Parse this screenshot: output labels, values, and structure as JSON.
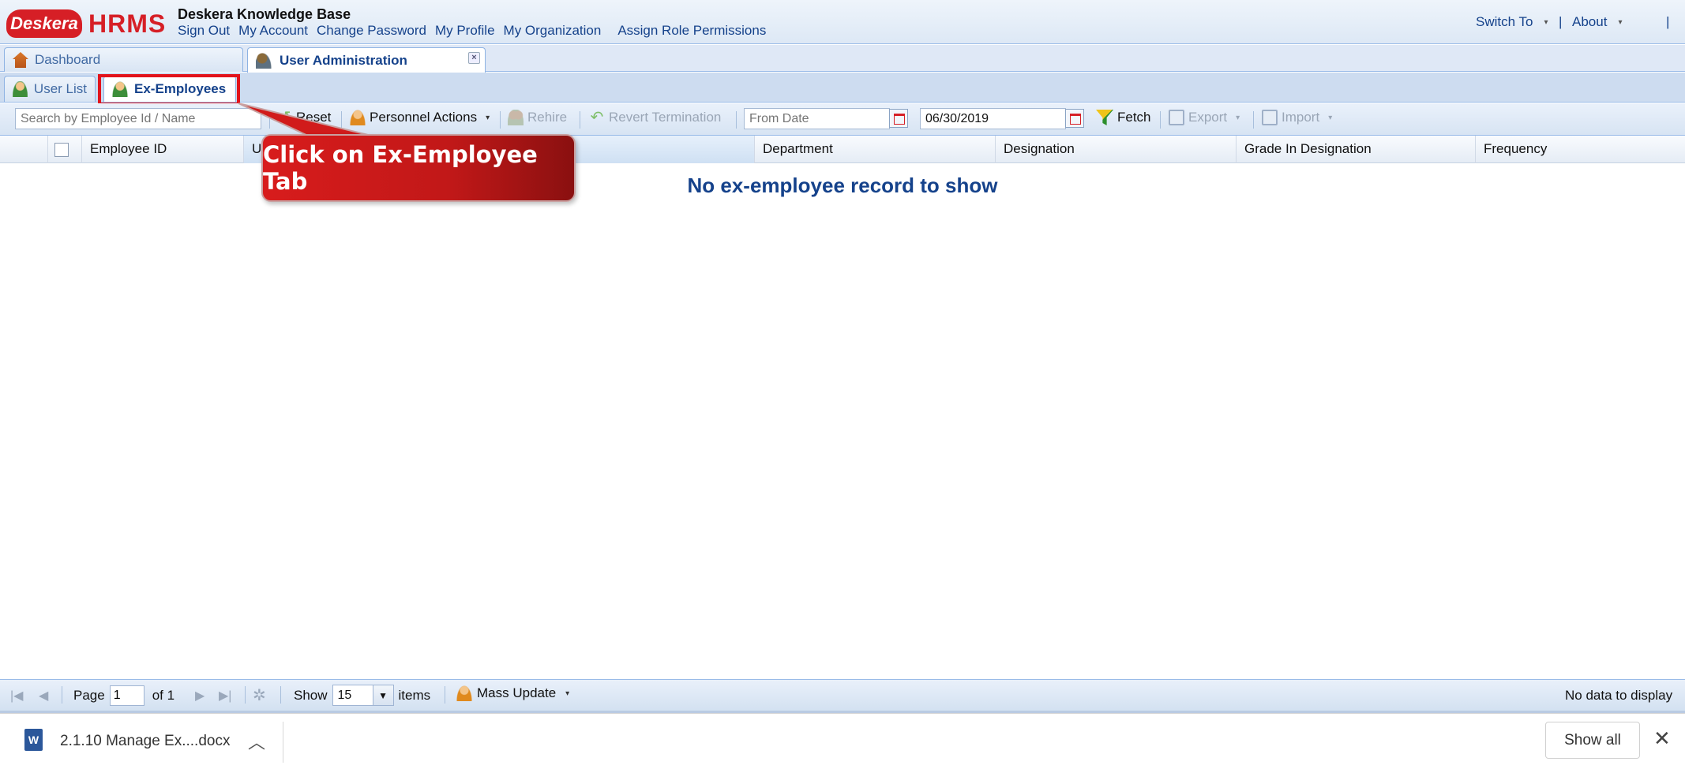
{
  "header": {
    "logo_text": "Deskera",
    "brand": "HRMS",
    "title": "Deskera Knowledge Base",
    "links": [
      "Sign Out",
      "My Account",
      "Change Password",
      "My Profile",
      "My Organization"
    ],
    "assign_link": "Assign Role Permissions",
    "switch_to": "Switch To",
    "separator": "|",
    "about": "About"
  },
  "main_tabs": [
    {
      "label": "Dashboard",
      "icon": "house-icon",
      "active": false
    },
    {
      "label": "User Administration",
      "icon": "admin-icon",
      "active": true,
      "close": "×"
    }
  ],
  "sub_tabs": [
    {
      "label": "User List",
      "icon": "person-icon",
      "active": false
    },
    {
      "label": "Ex-Employees",
      "icon": "person-icon",
      "active": true
    }
  ],
  "toolbar": {
    "search_placeholder": "Search by Employee Id / Name",
    "reset_label": "Reset",
    "personnel_actions": "Personnel Actions",
    "rehire": "Rehire",
    "revert_termination": "Revert Termination",
    "from_date_placeholder": "From Date",
    "to_date_value": "06/30/2019",
    "fetch": "Fetch",
    "export": "Export",
    "import": "Import"
  },
  "grid": {
    "columns": [
      "Employee ID",
      "U",
      "Department",
      "Designation",
      "Grade In Designation",
      "Frequency"
    ],
    "empty_message": "No ex-employee record to show"
  },
  "paging": {
    "page_label": "Page",
    "page_value": "1",
    "of_label": "of 1",
    "show_label": "Show",
    "page_size": "15",
    "items_label": "items",
    "mass_update": "Mass Update",
    "status": "No data to display"
  },
  "download_bar": {
    "file_name": "2.1.10 Manage Ex....docx",
    "doc_icon_letter": "W",
    "show_all": "Show all",
    "close": "✕"
  },
  "callout": {
    "text": "Click on Ex-Employee Tab"
  },
  "colors": {
    "accent": "#15428b",
    "brand_red": "#d61f26",
    "highlight": "#e2131b"
  }
}
